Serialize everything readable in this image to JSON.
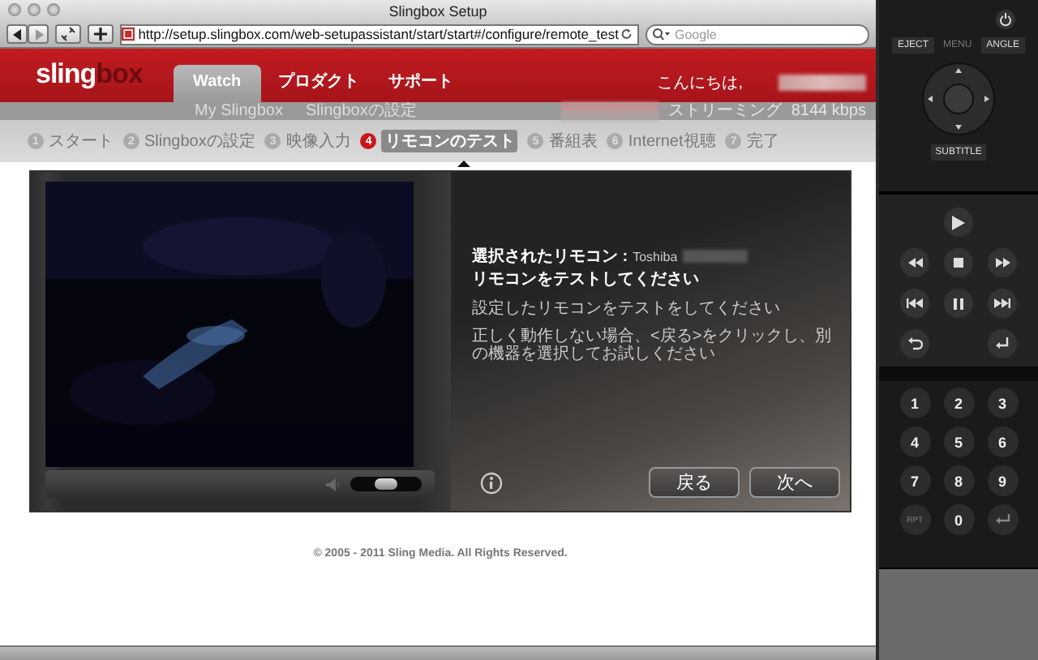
{
  "window": {
    "title": "Slingbox Setup"
  },
  "toolbar": {
    "url": "http://setup.slingbox.com/web-setupassistant/start/start#/configure/remote_test",
    "search": {
      "placeholder": "Google"
    }
  },
  "header": {
    "logo": [
      "sling",
      "box"
    ],
    "tabs": [
      {
        "label": "Watch",
        "selected": true
      },
      {
        "label": "プロダクト",
        "selected": false
      },
      {
        "label": "サポート",
        "selected": false
      }
    ],
    "greeting": "こんにちは,"
  },
  "subnav": {
    "links": [
      "My Slingbox",
      "Slingboxの設定"
    ],
    "streaming_label": "ストリーミング",
    "bitrate": "8144 kbps"
  },
  "steps": [
    {
      "number": "1",
      "label": "スタート",
      "selected": false
    },
    {
      "number": "2",
      "label": "Slingboxの設定",
      "selected": false
    },
    {
      "number": "3",
      "label": "映像入力",
      "selected": false
    },
    {
      "number": "4",
      "label": "リモコンのテスト",
      "selected": true
    },
    {
      "number": "5",
      "label": "番組表",
      "selected": false
    },
    {
      "number": "6",
      "label": "Internet視聴",
      "selected": false
    },
    {
      "number": "7",
      "label": "完了",
      "selected": false
    }
  ],
  "player": {
    "volume": {
      "level": 0.5
    }
  },
  "info": {
    "remote_label": "選択されたリモコン :",
    "remote_value": "Toshiba",
    "heading": "リモコンをテストしてください",
    "paragraphs": [
      "設定したリモコンをテストをしてください",
      "正しく動作しない場合、<戻る>をクリックし、別の機器を選択してお試しください"
    ],
    "buttons": [
      "戻る",
      "次へ"
    ]
  },
  "footer": "© 2005 - 2011 Sling Media. All Rights Reserved.",
  "remote": {
    "top_keys": [
      {
        "label": "EJECT",
        "disabled": false
      },
      {
        "label": "MENU",
        "disabled": true
      },
      {
        "label": "ANGLE",
        "disabled": false
      }
    ],
    "subtitle": "SUBTITLE",
    "keypad": [
      {
        "kind": "digit",
        "label": "1"
      },
      {
        "kind": "digit",
        "label": "2"
      },
      {
        "kind": "digit",
        "label": "3"
      },
      {
        "kind": "digit",
        "label": "4"
      },
      {
        "kind": "digit",
        "label": "5"
      },
      {
        "kind": "digit",
        "label": "6"
      },
      {
        "kind": "digit",
        "label": "7"
      },
      {
        "kind": "digit",
        "label": "8"
      },
      {
        "kind": "digit",
        "label": "9"
      },
      {
        "kind": "digit",
        "label": "RPT",
        "disabled": true
      },
      {
        "kind": "digit",
        "label": "0"
      },
      {
        "kind": "enter"
      }
    ]
  }
}
